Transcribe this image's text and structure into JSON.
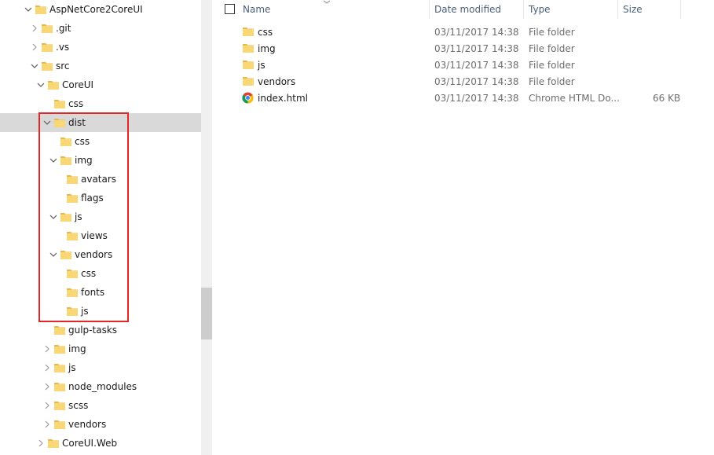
{
  "navigation_pane": {
    "items": [
      {
        "label": "AspNetCore2CoreUI",
        "expanded": true
      },
      {
        "label": ".git",
        "expanded": false
      },
      {
        "label": ".vs",
        "expanded": false
      },
      {
        "label": "src",
        "expanded": true
      },
      {
        "label": "CoreUI",
        "expanded": true
      },
      {
        "label": "css",
        "expanded": null
      },
      {
        "label": "dist",
        "expanded": true,
        "selected": true
      },
      {
        "label": "css",
        "expanded": null
      },
      {
        "label": "img",
        "expanded": true
      },
      {
        "label": "avatars",
        "expanded": null
      },
      {
        "label": "flags",
        "expanded": null
      },
      {
        "label": "js",
        "expanded": true
      },
      {
        "label": "views",
        "expanded": null
      },
      {
        "label": "vendors",
        "expanded": true
      },
      {
        "label": "css",
        "expanded": null
      },
      {
        "label": "fonts",
        "expanded": null
      },
      {
        "label": "js",
        "expanded": null
      },
      {
        "label": "gulp-tasks",
        "expanded": null
      },
      {
        "label": "img",
        "expanded": false
      },
      {
        "label": "js",
        "expanded": false
      },
      {
        "label": "node_modules",
        "expanded": false
      },
      {
        "label": "scss",
        "expanded": false
      },
      {
        "label": "vendors",
        "expanded": false
      },
      {
        "label": "CoreUI.Web",
        "expanded": false
      }
    ],
    "highlight_color": "#e32626",
    "selected_bg": "#d9d9d9"
  },
  "file_list": {
    "columns": {
      "name": "Name",
      "date_modified": "Date modified",
      "type": "Type",
      "size": "Size"
    },
    "rows": [
      {
        "name": "css",
        "date": "03/11/2017 14:38",
        "type": "File folder",
        "size": "",
        "icon": "folder-icon"
      },
      {
        "name": "img",
        "date": "03/11/2017 14:38",
        "type": "File folder",
        "size": "",
        "icon": "folder-icon"
      },
      {
        "name": "js",
        "date": "03/11/2017 14:38",
        "type": "File folder",
        "size": "",
        "icon": "folder-icon"
      },
      {
        "name": "vendors",
        "date": "03/11/2017 14:38",
        "type": "File folder",
        "size": "",
        "icon": "folder-icon"
      },
      {
        "name": "index.html",
        "date": "03/11/2017 14:38",
        "type": "Chrome HTML Do...",
        "size": "66 KB",
        "icon": "chrome-icon"
      }
    ]
  },
  "colors": {
    "folder": "#f8d775",
    "folder_dark": "#e8b84a",
    "header_text": "#4c607a"
  }
}
